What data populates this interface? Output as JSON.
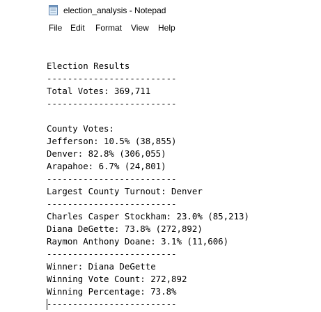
{
  "window": {
    "title": "election_analysis - Notepad",
    "app_icon": "notepad-icon"
  },
  "menu": {
    "file": "File",
    "edit": "Edit",
    "format": "Format",
    "view": "View",
    "help": "Help"
  },
  "document": {
    "lines": [
      "",
      "Election Results",
      "-------------------------",
      "Total Votes: 369,711",
      "-------------------------",
      "",
      "County Votes:",
      "Jefferson: 10.5% (38,855)",
      "Denver: 82.8% (306,055)",
      "Arapahoe: 6.7% (24,801)",
      "-------------------------",
      "Largest County Turnout: Denver",
      "-------------------------",
      "Charles Casper Stockham: 23.0% (85,213)",
      "Diana DeGette: 73.8% (272,892)",
      "Raymon Anthony Doane: 3.1% (11,606)",
      "-------------------------",
      "Winner: Diana DeGette",
      "Winning Vote Count: 272,892",
      "Winning Percentage: 73.8%",
      "-------------------------"
    ]
  }
}
